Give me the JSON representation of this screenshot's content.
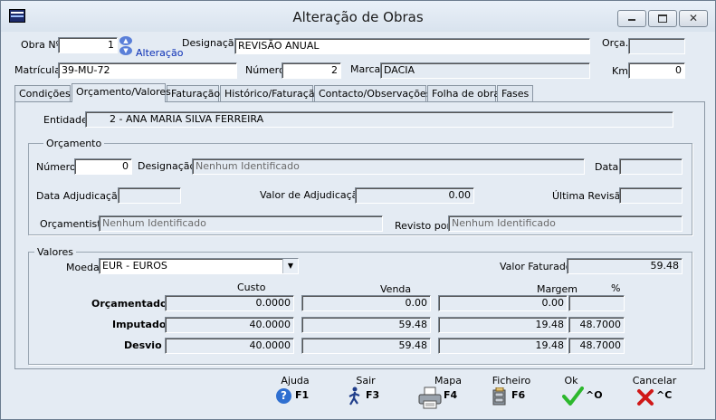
{
  "window": {
    "title": "Alteração de Obras"
  },
  "header": {
    "obra_label": "Obra Nº",
    "obra_value": "1",
    "alteracao_link": "Alteração",
    "designacao_label": "Designação",
    "designacao_value": "REVISÃO ANUAL",
    "orca_label": "Orça.",
    "orca_value": "",
    "matricula_label": "Matrícula",
    "matricula_value": "39-MU-72",
    "numero_label": "Número",
    "numero_value": "2",
    "marca_label": "Marca",
    "marca_value": "DACIA",
    "km_label": "Km",
    "km_value": "0"
  },
  "tabs": [
    "Condições",
    "Orçamento/Valores",
    "Faturação",
    "Histórico/Faturação",
    "Contacto/Observações",
    "Folha de obra",
    "Fases"
  ],
  "active_tab": "Orçamento/Valores",
  "entidade": {
    "label": "Entidade",
    "value": "2 - ANA MARIA SILVA FERREIRA"
  },
  "orcamento": {
    "title": "Orçamento",
    "numero_label": "Número",
    "numero_value": "0",
    "designacao_label": "Designação",
    "designacao_value": "Nenhum Identificado",
    "data_label": "Data",
    "data_value": "",
    "data_adj_label": "Data Adjudicação",
    "data_adj_value": "",
    "valor_adj_label": "Valor de Adjudicação",
    "valor_adj_value": "0.00",
    "ultima_rev_label": "Última Revisão",
    "ultima_rev_value": "",
    "orcamentista_label": "Orçamentista",
    "orcamentista_value": "Nenhum Identificado",
    "revisto_label": "Revisto por",
    "revisto_value": "Nenhum Identificado"
  },
  "valores": {
    "title": "Valores",
    "moeda_label": "Moeda",
    "moeda_value": "EUR - EUROS",
    "valor_faturado_label": "Valor Faturado",
    "valor_faturado_value": "59.48",
    "col_custo": "Custo",
    "col_venda": "Venda",
    "col_margem": "Margem",
    "col_pct": "%",
    "rows": [
      {
        "label": "Orçamentado",
        "custo": "0.0000",
        "venda": "0.00",
        "margem": "0.00",
        "pct": ""
      },
      {
        "label": "Imputado",
        "custo": "40.0000",
        "venda": "59.48",
        "margem": "19.48",
        "pct": "48.7000"
      },
      {
        "label": "Desvio",
        "custo": "40.0000",
        "venda": "59.48",
        "margem": "19.48",
        "pct": "48.7000"
      }
    ]
  },
  "footer": {
    "ajuda": {
      "label": "Ajuda",
      "key": "F1"
    },
    "sair": {
      "label": "Sair",
      "key": "F3"
    },
    "mapa": {
      "label": "Mapa",
      "key": "F4"
    },
    "ficheiro": {
      "label": "Ficheiro",
      "key": "F6"
    },
    "ok": {
      "label": "Ok",
      "key": "^O"
    },
    "cancelar": {
      "label": "Cancelar",
      "key": "^C"
    }
  },
  "colors": {
    "accent_link": "#0b2fb5",
    "ok_green": "#2db82d",
    "cancel_red": "#d01818",
    "help_blue": "#2f6fd0"
  }
}
